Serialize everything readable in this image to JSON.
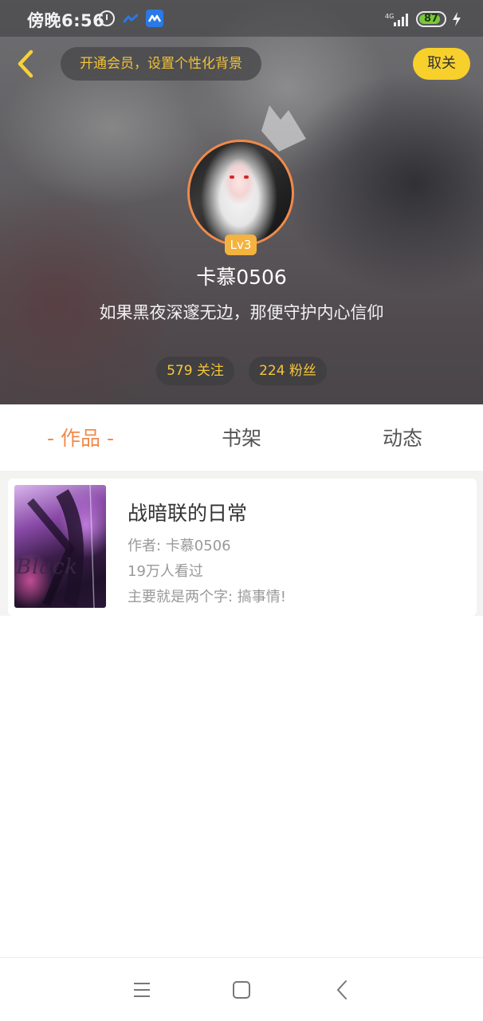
{
  "status_bar": {
    "time": "傍晚6:56",
    "network": "4G",
    "battery_percent": "87",
    "battery_level": 0.87,
    "icons": [
      "alarm-icon",
      "app-notification-icon",
      "app-notification-icon",
      "signal-icon",
      "battery-icon",
      "charging-icon"
    ]
  },
  "header": {
    "back_icon": "chevron-left-icon",
    "vip_banner": "开通会员，设置个性化背景",
    "unfollow_label": "取关"
  },
  "profile": {
    "level": "Lv3",
    "username": "卡慕0506",
    "signature": "如果黑夜深邃无边，那便守护内心信仰",
    "following": "579 关注",
    "followers": "224 粉丝"
  },
  "tabs": [
    {
      "label": "作品",
      "active": true
    },
    {
      "label": "书架",
      "active": false
    },
    {
      "label": "动态",
      "active": false
    }
  ],
  "tab_marker": "-",
  "works": [
    {
      "cover_text": "Black",
      "title": "战暗联的日常",
      "author": "作者: 卡慕0506",
      "views": "19万人看过",
      "description": "主要就是两个字: 搞事情!"
    }
  ],
  "nav": {
    "menu_icon": "menu-icon",
    "home_icon": "square-home-icon",
    "back_icon": "triangle-back-icon"
  },
  "colors": {
    "accent": "#f08a4b",
    "gold": "#f5c63a",
    "unfollow_bg": "#f7d02c",
    "level_bg": "#f4b23e"
  }
}
